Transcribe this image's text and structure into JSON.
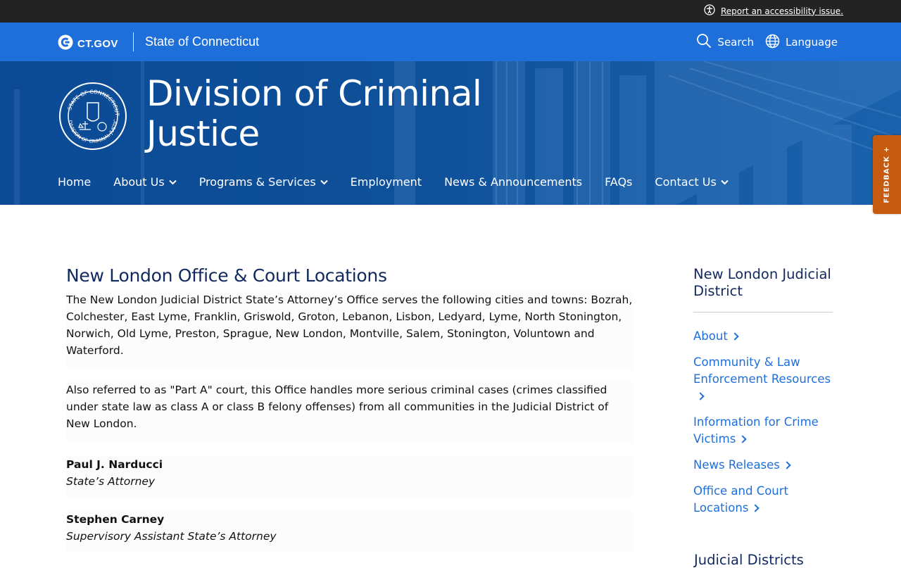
{
  "utility": {
    "a11y_label": "Report an accessibility issue.",
    "a11y_icon": "accessibility-icon"
  },
  "ctbar": {
    "logo_text": "CT.GOV",
    "state_label": "State of Connecticut",
    "search_label": "Search",
    "language_label": "Language"
  },
  "hero": {
    "title": "Division of Criminal Justice",
    "seal_alt": "Seal of Connecticut Division of Criminal Justice",
    "nav": [
      {
        "label": "Home",
        "dropdown": false
      },
      {
        "label": "About Us",
        "dropdown": true
      },
      {
        "label": "Programs & Services",
        "dropdown": true
      },
      {
        "label": "Employment",
        "dropdown": false
      },
      {
        "label": "News & Announcements",
        "dropdown": false
      },
      {
        "label": "FAQs",
        "dropdown": false
      },
      {
        "label": "Contact Us",
        "dropdown": true
      }
    ]
  },
  "feedback": {
    "label": "FEEDBACK +"
  },
  "main": {
    "title": "New London Office & Court Locations",
    "para1": "The New London Judicial District State’s Attorney’s Office serves the following cities and towns: Bozrah, Colchester, East Lyme, Franklin, Griswold, Groton, Lebanon, Lisbon, Ledyard, Lyme, North Stonington, Norwich, Old Lyme, Preston, Sprague, New London, Montville, Salem, Stonington, Voluntown and Waterford.",
    "para2": "Also referred to as \"Part A\" court, this Office handles more serious criminal cases (crimes classified under state law as class A or class B felony offenses) from all communities in the Judicial District of New London.",
    "people": [
      {
        "name": "Paul J. Narducci",
        "role": "State’s Attorney"
      },
      {
        "name": "Stephen Carney",
        "role": "Supervisory Assistant State’s Attorney"
      }
    ]
  },
  "sidebar": {
    "title": "New London Judicial District",
    "links": [
      "About",
      "Community & Law Enforcement Resources",
      "Information for Crime Victims",
      "News Releases",
      "Office and Court Locations"
    ],
    "next_heading": "Judicial Districts"
  },
  "colors": {
    "primary": "#1f6fdb",
    "hero": "#0d4f9e",
    "heading": "#12295e",
    "feedback": "#c55a11",
    "utility": "#232323"
  }
}
